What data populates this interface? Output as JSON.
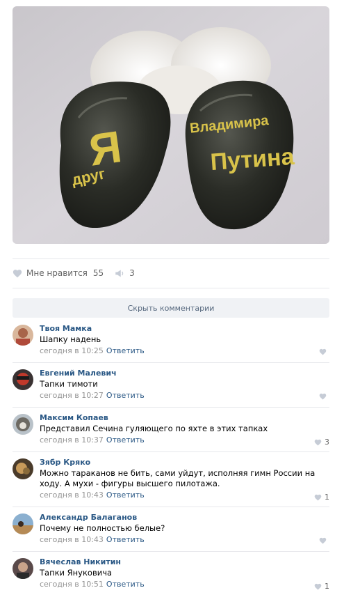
{
  "post": {
    "likes_label": "Мне нравится",
    "likes_count": "55",
    "reposts_count": "3"
  },
  "hide_comments_label": "Скрыть комментарии",
  "comments": [
    {
      "author": "Твоя Мамка",
      "text": "Шапку надень",
      "time": "сегодня в 10:25",
      "reply": "Ответить",
      "likes": ""
    },
    {
      "author": "Евгений Малевич",
      "text": "Тапки тимоти",
      "time": "сегодня в 10:27",
      "reply": "Ответить",
      "likes": ""
    },
    {
      "author": "Максим Копаев",
      "text": "Представил Сечина гуляющего по яхте в этих тапках",
      "time": "сегодня в 10:37",
      "reply": "Ответить",
      "likes": "3"
    },
    {
      "author": "Зябр Кряко",
      "text": "Можно тараканов не бить, сами уйдут, исполняя гимн России на ходу. А мухи - фигуры высшего пилотажа.",
      "time": "сегодня в 10:43",
      "reply": "Ответить",
      "likes": "1"
    },
    {
      "author": "Александр Балаганов",
      "text": "Почему не полностью белые?",
      "time": "сегодня в 10:43",
      "reply": "Ответить",
      "likes": ""
    },
    {
      "author": "Вячеслав Никитин",
      "text": "Тапки Януковича",
      "time": "сегодня в 10:51",
      "reply": "Ответить",
      "likes": "1"
    }
  ],
  "photo": {
    "left_slipper_text": [
      "Я",
      "друг"
    ],
    "right_slipper_text": [
      "Владимира",
      "Путина"
    ]
  },
  "icons": {
    "like": "heart-icon",
    "repost": "megaphone-icon"
  },
  "colors": {
    "link": "#2a5885",
    "meta": "#939393",
    "gold": "#d9c34a"
  }
}
